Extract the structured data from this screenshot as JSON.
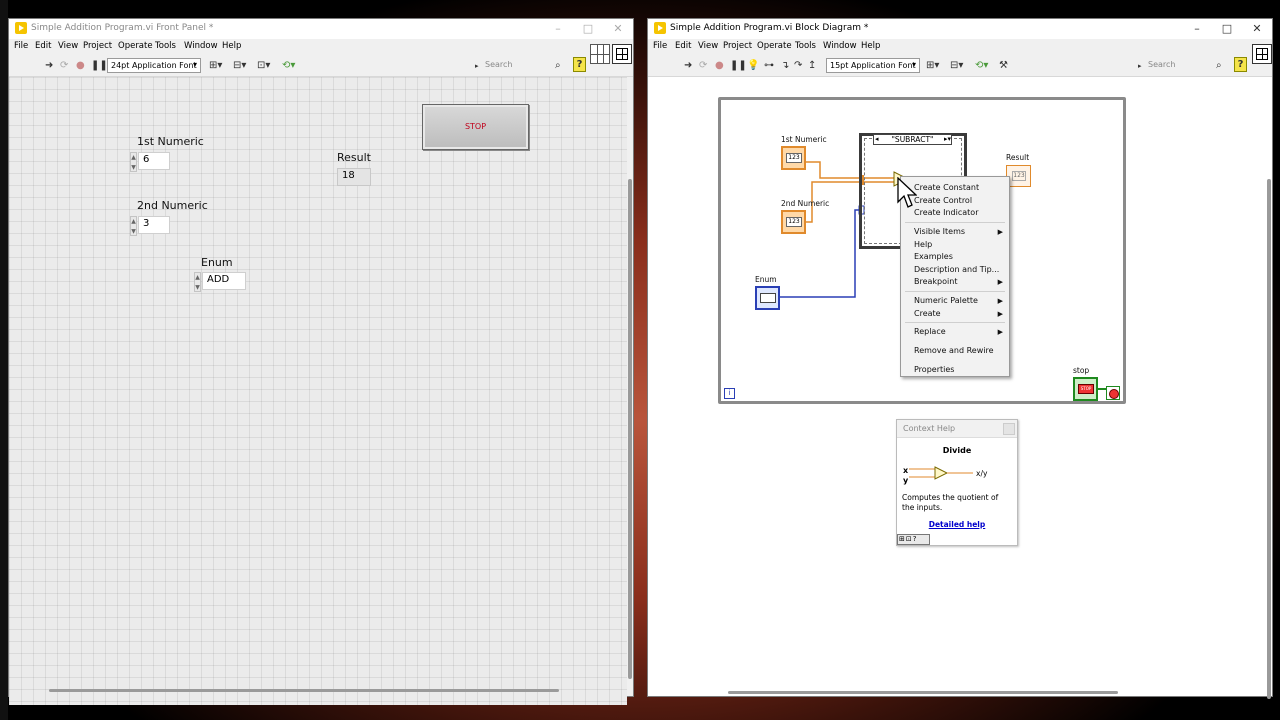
{
  "front_panel": {
    "title": "Simple Addition Program.vi Front Panel *",
    "menu": [
      "File",
      "Edit",
      "View",
      "Project",
      "Operate",
      "Tools",
      "Window",
      "Help"
    ],
    "font": "24pt Application Font",
    "search_placeholder": "Search",
    "controls": {
      "num1_label": "1st Numeric",
      "num1_value": "6",
      "num2_label": "2nd Numeric",
      "num2_value": "3",
      "result_label": "Result",
      "result_value": "18",
      "enum_label": "Enum",
      "enum_value": "ADD",
      "stop_label": "STOP"
    }
  },
  "block_diagram": {
    "title": "Simple Addition Program.vi Block Diagram *",
    "menu": [
      "File",
      "Edit",
      "View",
      "Project",
      "Operate",
      "Tools",
      "Window",
      "Help"
    ],
    "font": "15pt Application Font",
    "search_placeholder": "Search",
    "case_selector": "\"SUBRACT\"",
    "labels": {
      "num1": "1st Numeric",
      "num2": "2nd Numeric",
      "enum": "Enum",
      "result": "Result",
      "stop": "stop",
      "num_icon": "123",
      "stop_icon": "STOP",
      "iteration": "i"
    }
  },
  "context_menu": {
    "items": [
      {
        "label": "Create Constant"
      },
      {
        "label": "Create Control"
      },
      {
        "label": "Create Indicator"
      },
      {
        "label": "Visible Items"
      },
      {
        "label": "Help"
      },
      {
        "label": "Examples"
      },
      {
        "label": "Description and Tip..."
      },
      {
        "label": "Breakpoint"
      },
      {
        "label": "Numeric Palette"
      },
      {
        "label": "Create"
      },
      {
        "label": "Replace"
      },
      {
        "label": "Remove and Rewire"
      },
      {
        "label": "Properties"
      }
    ]
  },
  "context_help": {
    "title": "Context Help",
    "function": "Divide",
    "in_x": "x",
    "in_y": "y",
    "output": "x/y",
    "description": "Computes the quotient of the inputs.",
    "link": "Detailed help"
  },
  "colors": {
    "numeric_wire": "#e08a2c",
    "enum_wire": "#2a3fb5",
    "boolean_wire": "#1f8a1f"
  }
}
